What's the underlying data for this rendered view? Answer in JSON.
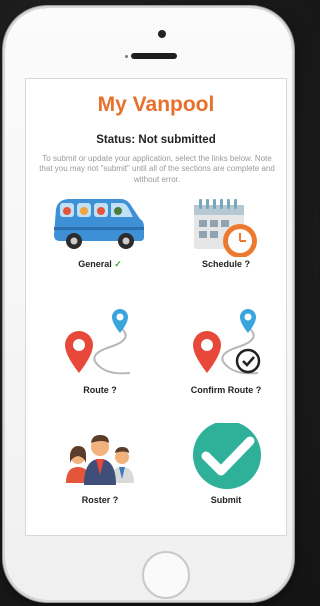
{
  "app": {
    "title": "My Vanpool",
    "status": "Status: Not submitted",
    "instructions": "To submit or update your application, select the links below. Note that you may not \"submit\" until all of the sections are complete and without error."
  },
  "tiles": [
    {
      "label": "General",
      "status_mark": "✓",
      "icon": "van-icon"
    },
    {
      "label": "Schedule ?",
      "icon": "calendar-clock-icon"
    },
    {
      "label": "Route ?",
      "icon": "route-pins-icon"
    },
    {
      "label": "Confirm Route ?",
      "icon": "route-confirm-icon"
    },
    {
      "label": "Roster ?",
      "icon": "people-icon"
    },
    {
      "label": "Submit",
      "icon": "checkmark-circle-icon"
    }
  ],
  "colors": {
    "accent": "#e8702a",
    "check": "#3aa63a",
    "van": "#3d8fd6",
    "pin_red": "#e8483a",
    "pin_blue": "#3aa4dc",
    "submit_green": "#2fb199"
  }
}
